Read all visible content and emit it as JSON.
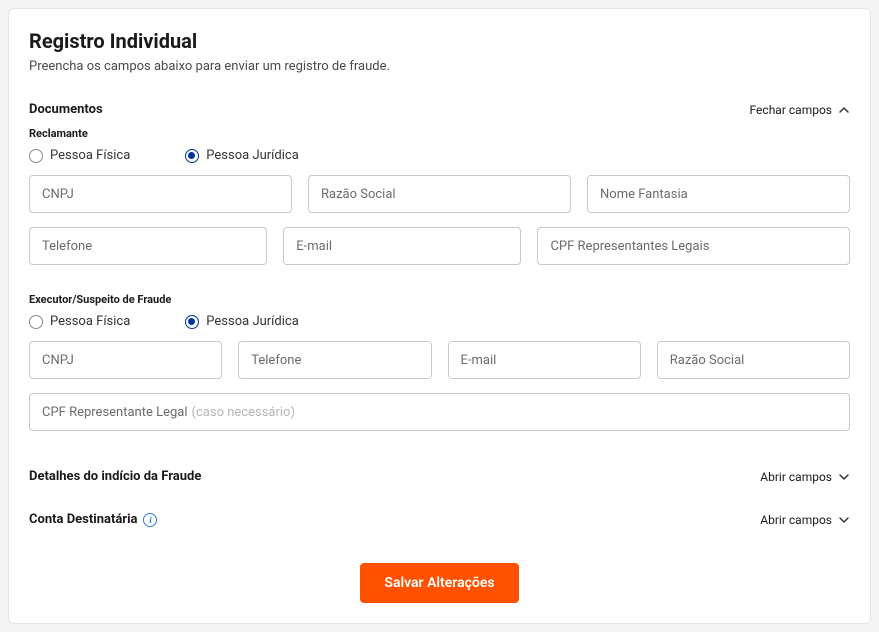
{
  "page": {
    "title": "Registro Individual",
    "subtitle": "Preencha os campos abaixo para enviar um registro de fraude."
  },
  "sections": {
    "documentos": {
      "title": "Documentos",
      "toggle": "Fechar campos"
    },
    "reclamante": {
      "label": "Reclamante",
      "radios": {
        "fisica": "Pessoa Física",
        "juridica": "Pessoa Jurídica"
      },
      "fields": {
        "cnpj": "CNPJ",
        "razao_social": "Razão Social",
        "nome_fantasia": "Nome Fantasia",
        "telefone": "Telefone",
        "email": "E-mail",
        "cpf_reps": "CPF Representantes Legais"
      }
    },
    "executor": {
      "label": "Executor/Suspeito de Fraude",
      "radios": {
        "fisica": "Pessoa Física",
        "juridica": "Pessoa Jurídica"
      },
      "fields": {
        "cnpj": "CNPJ",
        "telefone": "Telefone",
        "email": "E-mail",
        "razao_social": "Razão Social",
        "cpf_rep_main": "CPF Representante Legal",
        "cpf_rep_hint": "(caso necessário)"
      }
    },
    "detalhes": {
      "title": "Detalhes do indício da Fraude",
      "toggle": "Abrir campos"
    },
    "conta": {
      "title": "Conta Destinatária",
      "toggle": "Abrir campos"
    }
  },
  "actions": {
    "save": "Salvar Alterações"
  }
}
